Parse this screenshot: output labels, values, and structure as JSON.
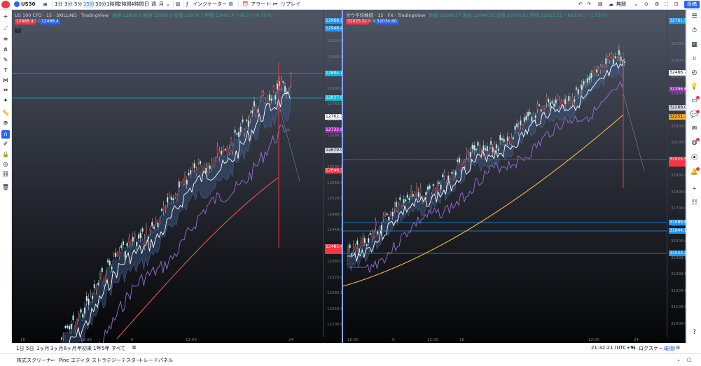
{
  "topbar": {
    "symbol": "US30",
    "intervals": [
      "1分",
      "3分",
      "5分",
      "15分",
      "30分",
      "1時間",
      "2時間",
      "4時間",
      "日",
      "週",
      "月"
    ],
    "active_interval": "15分",
    "indicators_label": "インジケーター",
    "alert_label": "アラート",
    "replay_label": "リプレイ",
    "layout_label": "無題",
    "publish_label": "投稿"
  },
  "left_chart": {
    "title": "US 100 CFD · 15 · SKILLING · TradingView",
    "ohlc_text": "始値 12868.8  高値 12860.8  安値 12879.7  終値 12485.4  −96.0 (−0.75%)",
    "sell_price": "12485.4",
    "spread": "1.0",
    "buy_price": "12486.4",
    "price_labels": [
      {
        "text": "12968.1",
        "color": "#2196f3"
      },
      {
        "text": "12948.4",
        "color": "#2196f3"
      },
      {
        "text": "12894.1",
        "color": "#00bcd4"
      },
      {
        "text": "12837.0",
        "color": "#00bcd4"
      },
      {
        "text": "12762.3",
        "color": "#ffffff"
      },
      {
        "text": "12732.6",
        "color": "#9c27b0"
      },
      {
        "text": "12679.9",
        "color": "#d1d4dc"
      },
      {
        "text": "12646.3",
        "color": "#f23645"
      },
      {
        "text": "12485.4",
        "color": "#f23645"
      }
    ],
    "y_ticks": [
      "12920.0",
      "12880.0",
      "12840.0",
      "12800.0",
      "12760.0",
      "12720.0",
      "12680.0",
      "12640.0",
      "12600.0",
      "12560.0",
      "12520.0",
      "12480.0",
      "12440.0",
      "12400.0",
      "12360.0",
      "12320.0",
      "12280.0",
      "12240.0",
      "12200.0"
    ],
    "x_ticks": [
      "16",
      "12:00",
      "6",
      "12:00",
      "24"
    ]
  },
  "right_chart": {
    "title": "ダウ平均株価 · 15 · FX · TradingView",
    "ohlc_text": "始値 31888.57  高値 32644.31  安値 31870.81  終値 32025.51  −663.80 (−1.73%)",
    "sell_price": "32025.51",
    "spread": "8.90",
    "buy_price": "32034.60",
    "price_labels": [
      {
        "text": "32761.56",
        "color": "#2196f3"
      },
      {
        "text": "32486.75",
        "color": "#ffffff"
      },
      {
        "text": "32396.66",
        "color": "#9c27b0"
      },
      {
        "text": "32289.01",
        "color": "#d1d4dc"
      },
      {
        "text": "32251.71",
        "color": "#f5a623"
      },
      {
        "text": "32025.51",
        "color": "#f23645"
      },
      {
        "text": "31689.87",
        "color": "#2196f3"
      },
      {
        "text": "31644.19",
        "color": "#2196f3"
      },
      {
        "text": "31523.39",
        "color": "#2196f3"
      }
    ],
    "y_ticks": [
      "32700.00",
      "32600.00",
      "32500.00",
      "32400.00",
      "32300.00",
      "32200.00",
      "32100.00",
      "32000.00",
      "31900.00",
      "31800.00",
      "31700.00",
      "31600.00",
      "31500.00",
      "31400.00",
      "31300.00",
      "31200.00",
      "31100.00",
      "31000.00"
    ],
    "x_ticks": [
      "16:00",
      "6",
      "12:00",
      "18",
      "12:00",
      "24"
    ]
  },
  "bottombar": {
    "ranges": [
      "1日",
      "5日",
      "1ヶ月",
      "3ヶ月",
      "6ヶ月",
      "年初来",
      "1年",
      "5年",
      "すべて"
    ],
    "time": "21:32:21 (UTC+9)",
    "percent": "%",
    "log": "ログスケール",
    "auto": "自動"
  },
  "panelbar": {
    "tabs": [
      "株式スクリーナー",
      "Pine エディタ",
      "ストラテジーテスター",
      "トレードパネル"
    ]
  },
  "colors": {
    "accent": "#2962ff",
    "up": "#26a69a",
    "down": "#f23645",
    "white_ma": "#ffffff",
    "purple_ma": "#9c6cd6",
    "red_ma": "#ef5350",
    "yellow_ma": "#f5b942",
    "cloud": "#3d5a8a"
  }
}
